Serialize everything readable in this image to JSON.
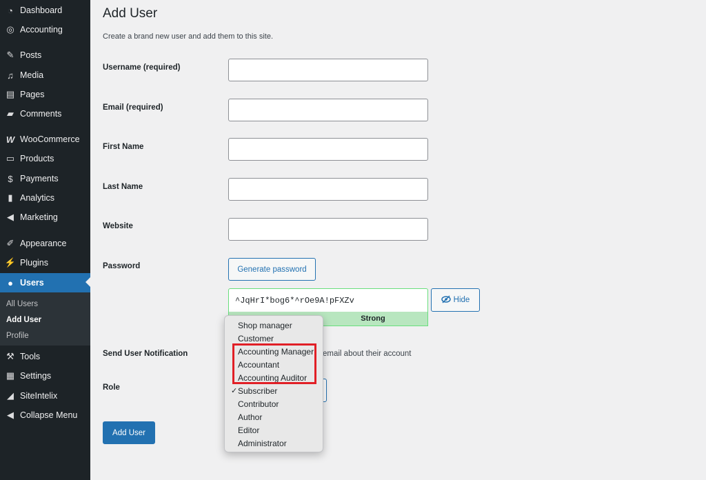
{
  "sidebar": {
    "items": [
      {
        "label": "Dashboard",
        "icon": "dashboard-icon"
      },
      {
        "label": "Accounting",
        "icon": "accounting-icon"
      },
      {
        "label": "Posts",
        "icon": "pin-icon"
      },
      {
        "label": "Media",
        "icon": "media-icon"
      },
      {
        "label": "Pages",
        "icon": "pages-icon"
      },
      {
        "label": "Comments",
        "icon": "comments-icon"
      },
      {
        "label": "WooCommerce",
        "icon": "woocommerce-icon"
      },
      {
        "label": "Products",
        "icon": "products-icon"
      },
      {
        "label": "Payments",
        "icon": "payments-icon"
      },
      {
        "label": "Analytics",
        "icon": "analytics-icon"
      },
      {
        "label": "Marketing",
        "icon": "megaphone-icon"
      },
      {
        "label": "Appearance",
        "icon": "brush-icon"
      },
      {
        "label": "Plugins",
        "icon": "plugin-icon"
      },
      {
        "label": "Users",
        "icon": "user-icon"
      },
      {
        "label": "Tools",
        "icon": "wrench-icon"
      },
      {
        "label": "Settings",
        "icon": "settings-icon"
      },
      {
        "label": "SiteIntelix",
        "icon": "siteintelix-icon"
      },
      {
        "label": "Collapse Menu",
        "icon": "collapse-icon"
      }
    ],
    "submenu": [
      "All Users",
      "Add User",
      "Profile"
    ]
  },
  "main": {
    "title": "Add User",
    "description": "Create a brand new user and add them to this site.",
    "fields": {
      "username": {
        "label": "Username",
        "note": "(required)",
        "value": ""
      },
      "email": {
        "label": "Email",
        "note": "(required)",
        "value": ""
      },
      "first_name": {
        "label": "First Name",
        "value": ""
      },
      "last_name": {
        "label": "Last Name",
        "value": ""
      },
      "website": {
        "label": "Website",
        "value": ""
      }
    },
    "password": {
      "label": "Password",
      "generate_label": "Generate password",
      "value": "^JqHrI*bog6*^rOe9A!pFXZv",
      "hide_label": "Hide",
      "strength": "Strong"
    },
    "notification": {
      "label": "Send User Notification",
      "text": "email about their account"
    },
    "role": {
      "label": "Role",
      "selected": "Subscriber",
      "options": [
        "Shop manager",
        "Customer",
        "Accounting Manager",
        "Accountant",
        "Accounting Auditor",
        "Subscriber",
        "Contributor",
        "Author",
        "Editor",
        "Administrator"
      ]
    },
    "submit_label": "Add User"
  },
  "colors": {
    "sidebar_bg": "#1d2327",
    "accent": "#2271b1",
    "strength_bg": "#b8e6bf",
    "highlight": "#e11f26"
  }
}
